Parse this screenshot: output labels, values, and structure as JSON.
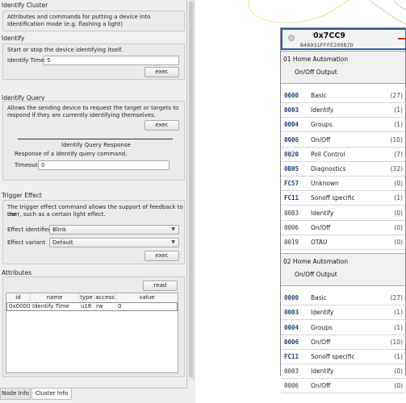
{
  "identify_cluster": {
    "title": "Identify Cluster",
    "description": "Attributes and commands for putting a device into Identification mode (e.g. flashing a light)"
  },
  "identify": {
    "title": "Identify",
    "description": "Start or stop the device identifying itself.",
    "time_label": "Identify Time",
    "time_value": "5",
    "exec_label": "exec"
  },
  "identify_query": {
    "title": "Identify Query",
    "description_line1": "Allows the sending device to request the target or targets to",
    "description_line2": "respond if they are currently identifying themselves.",
    "exec_label": "exec",
    "response_title": "Identify Query Response",
    "response_desc": "Response of a identify query command.",
    "timeout_label": "Timeout",
    "timeout_value": "0"
  },
  "trigger_effect": {
    "title": "Trigger Effect",
    "description_line1": "The trigger effect command allows the support of feedback to the",
    "description_line2": "user, such as a certain light effect.",
    "effect_identifier_label": "Effect identifier",
    "effect_identifier_value": "Blink",
    "effect_variant_label": "Effect variant",
    "effect_variant_value": "Default",
    "exec_label": "exec"
  },
  "attributes": {
    "title": "Attributes",
    "read_label": "read",
    "columns": [
      "id",
      "name",
      "type",
      "access",
      "value"
    ],
    "rows": [
      {
        "id": "0x0000",
        "name": "Identify Time",
        "type": "u16",
        "access": "rw",
        "value": "0"
      }
    ]
  },
  "tabs": [
    {
      "label": "Node Info",
      "active": false
    },
    {
      "label": "Cluster Info",
      "active": true
    }
  ],
  "node": {
    "title": "0x7CC9",
    "mac": "B48931FFFE20987D",
    "header_border_color": "#2e5f9f",
    "endpoints": [
      {
        "line1": "01  Home Automation",
        "line2": "On/Off Output",
        "clusters": [
          {
            "id": "0000",
            "name": "Basic",
            "count": "(27)",
            "bold": true
          },
          {
            "id": "0003",
            "name": "Identify",
            "count": "(1)",
            "bold": true
          },
          {
            "id": "0004",
            "name": "Groups",
            "count": "(1)",
            "bold": true
          },
          {
            "id": "0006",
            "name": "On/Off",
            "count": "(10)",
            "bold": true
          },
          {
            "id": "0020",
            "name": "Poll Control",
            "count": "(7)",
            "bold": true
          },
          {
            "id": "0B05",
            "name": "Diagnostics",
            "count": "(32)",
            "bold": true
          },
          {
            "id": "FC57",
            "name": "Unknown",
            "count": "(0)",
            "bold": true
          },
          {
            "id": "FC11",
            "name": "Sonoff specific",
            "count": "(1)",
            "bold": true
          },
          {
            "id": "0003",
            "name": "Identify",
            "count": "(0)",
            "bold": false
          },
          {
            "id": "0006",
            "name": "On/Off",
            "count": "(0)",
            "bold": false
          },
          {
            "id": "0019",
            "name": "OTAU",
            "count": "(0)",
            "bold": false
          }
        ]
      },
      {
        "line1": "02  Home Automation",
        "line2": "On/Off Output",
        "clusters": [
          {
            "id": "0000",
            "name": "Basic",
            "count": "(27)",
            "bold": true
          },
          {
            "id": "0003",
            "name": "Identify",
            "count": "(1)",
            "bold": true
          },
          {
            "id": "0004",
            "name": "Groups",
            "count": "(1)",
            "bold": true
          },
          {
            "id": "0006",
            "name": "On/Off",
            "count": "(10)",
            "bold": true
          },
          {
            "id": "FC11",
            "name": "Sonoff specific",
            "count": "(1)",
            "bold": true
          },
          {
            "id": "0003",
            "name": "Identify",
            "count": "(0)",
            "bold": false
          },
          {
            "id": "0006",
            "name": "On/Off",
            "count": "(0)",
            "bold": false
          }
        ]
      }
    ]
  }
}
